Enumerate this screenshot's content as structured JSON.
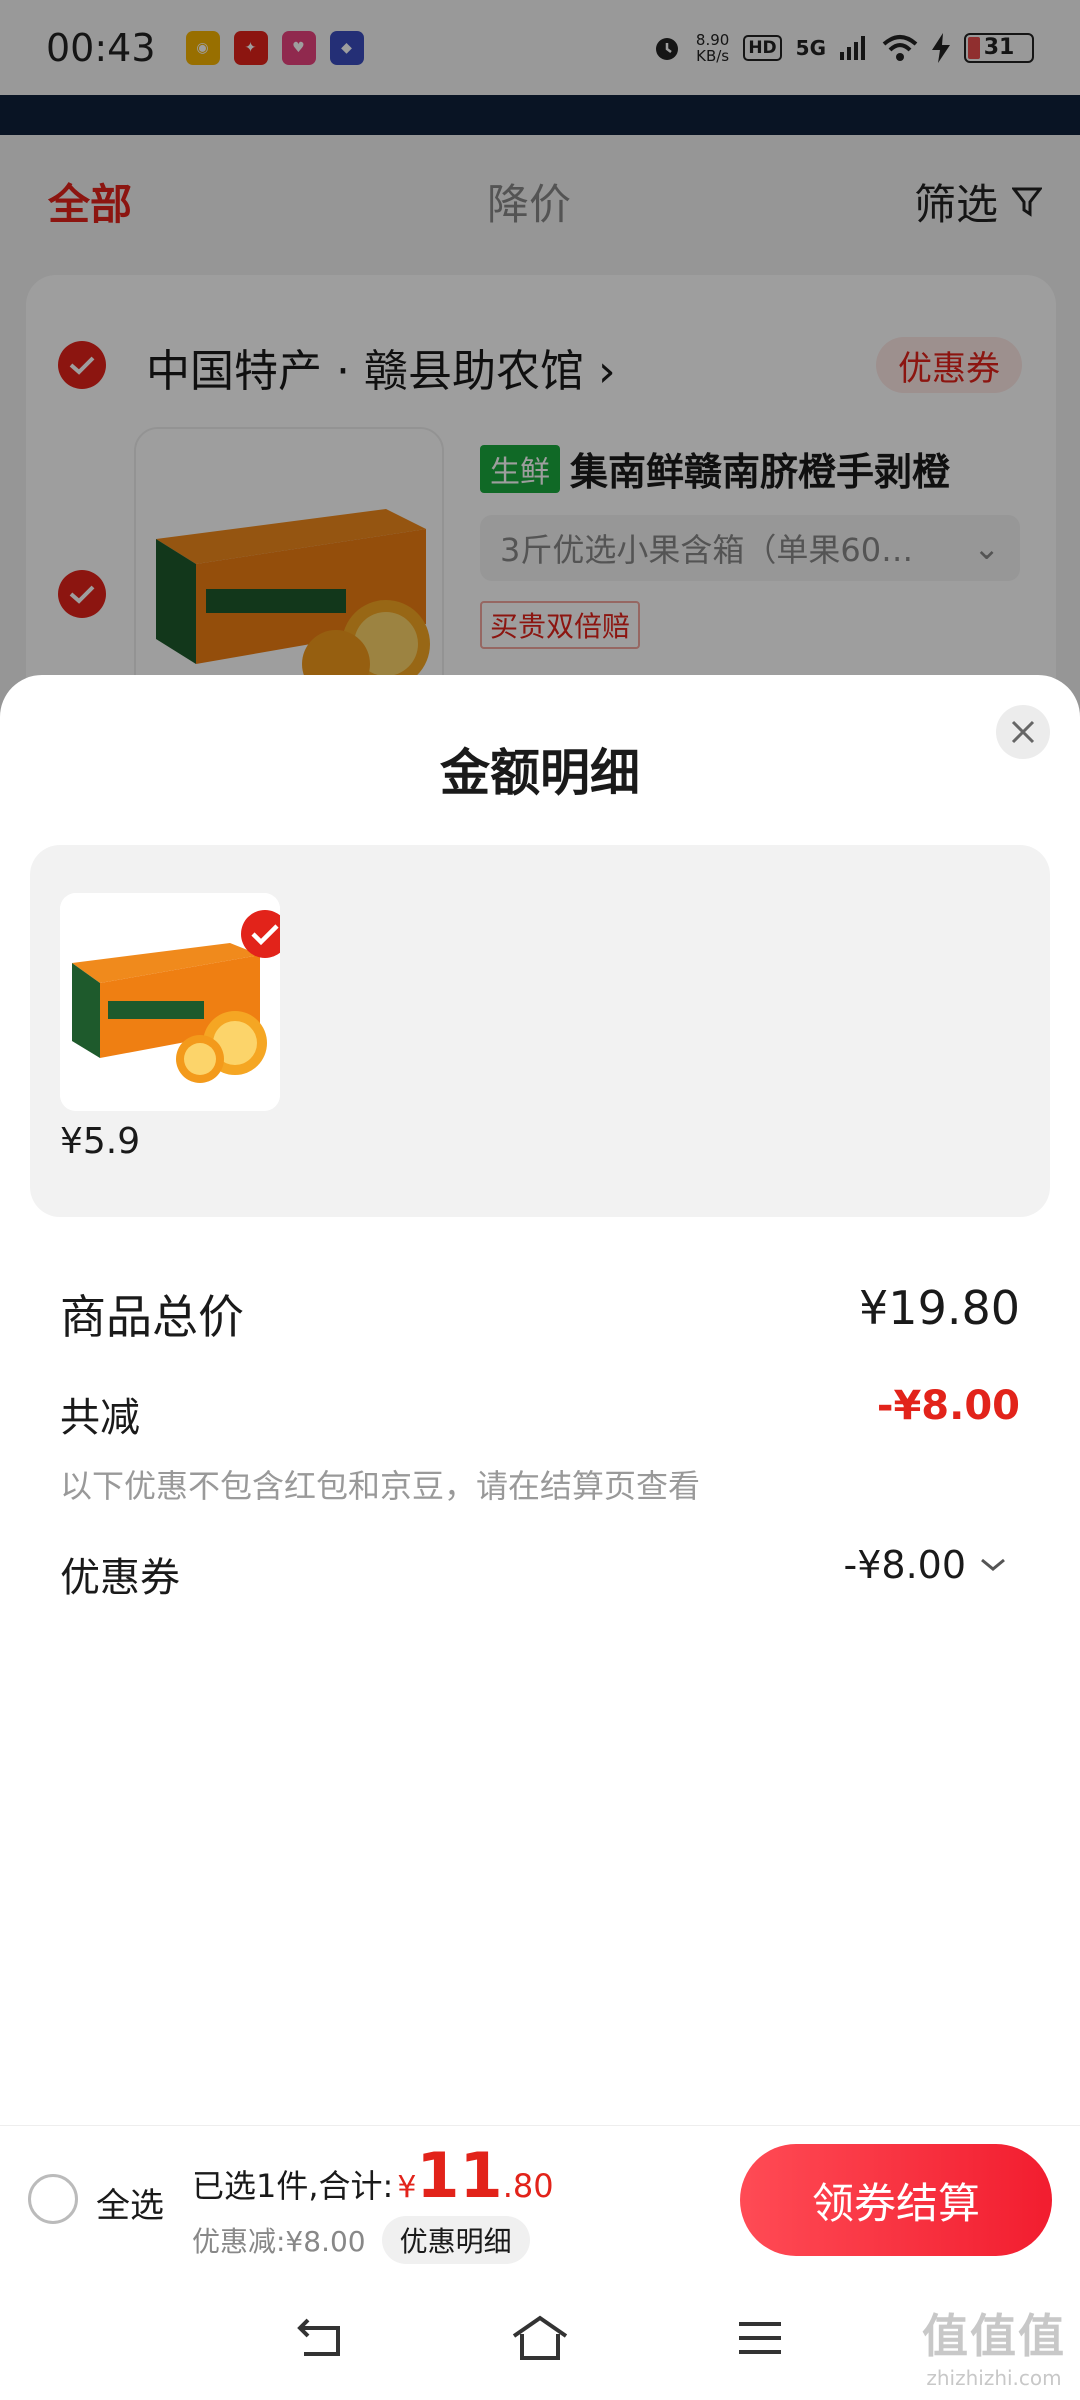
{
  "status_bar": {
    "time": "00:43",
    "speed_value": "8.90",
    "speed_unit": "KB/s",
    "hd": "HD",
    "network": "5G",
    "battery": "31"
  },
  "cart": {
    "tabs": {
      "all": "全部",
      "price_drop": "降价",
      "filter": "筛选"
    },
    "store_name": "中国特产 · 赣县助农馆 ›",
    "coupon_tag": "优惠券",
    "fresh_tag": "生鲜",
    "product_title": "集南鲜赣南脐橙手剥橙",
    "spec": "3斤优选小果含箱（单果60…",
    "guarantee": "买贵双倍赔"
  },
  "sheet": {
    "title": "金额明细",
    "item_price": "¥5.9",
    "rows": {
      "total_label": "商品总价",
      "total_value": "¥19.80",
      "reduce_label": "共减",
      "reduce_value": "-¥8.00",
      "note": "以下优惠不包含红包和京豆，请在结算页查看",
      "coupon_label": "优惠券",
      "coupon_value": "-¥8.00"
    }
  },
  "checkout": {
    "select_all": "全选",
    "selected_text": "已选1件,合计:",
    "yen": "¥",
    "amount_int": "11",
    "amount_dec": ".80",
    "discount_text": "优惠减:¥8.00",
    "discount_detail_btn": "优惠明细",
    "pay_button": "领券结算"
  },
  "watermark": {
    "big": "值值值",
    "small": "zhizhizhi.com"
  },
  "colors": {
    "accent": "#e2231a",
    "fresh_green": "#1aaa3e",
    "navy": "#10213a"
  },
  "icons": [
    "filter-icon",
    "check-icon",
    "close-icon",
    "chevron-down-icon",
    "back-icon",
    "home-icon",
    "menu-icon"
  ]
}
